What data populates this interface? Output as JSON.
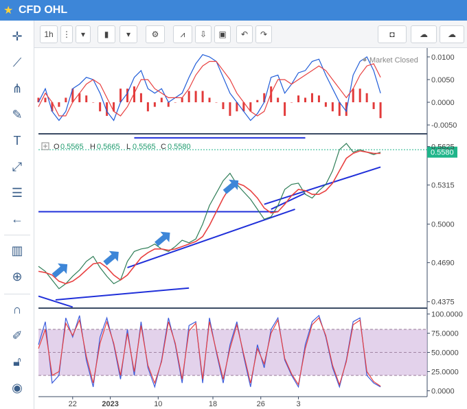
{
  "window": {
    "title": "CFD OHL"
  },
  "toolbar": {
    "interval": "1h"
  },
  "icons": [
    "star-icon",
    "crosshair-icon",
    "trendline-icon",
    "pitchfork-icon",
    "brush-icon",
    "text-icon",
    "pattern-icon",
    "fib-icon",
    "back-arrow-icon",
    "bar-chart-icon",
    "zoom-in-icon",
    "magnet-icon",
    "lock-pencil-icon",
    "unlock-icon",
    "eye-icon",
    "candlestick-icon",
    "gear-icon",
    "indicators-icon",
    "arrow-down-save-icon",
    "save-icon",
    "undo-icon",
    "redo-icon",
    "camera-icon",
    "cloud-download-icon",
    "cloud-upload-icon"
  ],
  "colors": {
    "accent": "#3d86d8",
    "price_line": "#1e5bd8",
    "ma": "#e84040",
    "hist": "#e23b3b",
    "stoch_band": "#d7bfe3",
    "last_price": "#1fb58a",
    "drawing": "#1f2fd9",
    "arrow": "#3d86d8"
  },
  "chart_data": [
    {
      "type": "line",
      "name": "macd-pane",
      "status": "Market Closed",
      "ylim": [
        -0.0065,
        0.0115
      ],
      "yticks": [
        "0.0100",
        "0.0050",
        "0.0000",
        "-0.0050"
      ],
      "x": [
        0,
        2,
        4,
        6,
        8,
        10,
        12,
        14,
        16,
        18,
        20,
        22,
        24,
        26,
        28,
        30,
        32,
        34,
        36,
        38,
        40,
        42,
        44,
        46,
        48,
        50,
        52,
        54,
        56,
        58,
        60,
        62,
        64,
        66,
        68,
        70,
        72,
        74,
        76,
        78,
        80,
        82,
        84,
        86,
        88,
        90,
        92,
        94,
        96,
        98,
        100
      ],
      "series": [
        {
          "values": [
            0.0,
            0.003,
            -0.002,
            -0.004,
            -0.002,
            0.003,
            0.004,
            0.0055,
            0.005,
            0.002,
            -0.002,
            -0.004,
            0.0,
            0.002,
            0.0055,
            0.007,
            0.003,
            0.002,
            0.003,
            0.0,
            0.001,
            0.002,
            0.0055,
            0.0085,
            0.0105,
            0.01,
            0.009,
            0.0055,
            0.002,
            0.0,
            -0.002,
            -0.004,
            -0.0025,
            0.0,
            0.0055,
            0.006,
            0.002,
            0.004,
            0.0065,
            0.007,
            0.009,
            0.0095,
            0.006,
            0.003,
            0.0,
            -0.002,
            0.006,
            0.009,
            0.01,
            0.007,
            0.002
          ]
        },
        {
          "values": [
            -0.001,
            0.002,
            0.0,
            -0.003,
            -0.003,
            0.0,
            0.002,
            0.004,
            0.005,
            0.004,
            0.001,
            -0.002,
            -0.003,
            -0.001,
            0.002,
            0.005,
            0.005,
            0.003,
            0.002,
            0.001,
            0.001,
            0.001,
            0.003,
            0.006,
            0.008,
            0.009,
            0.009,
            0.007,
            0.005,
            0.002,
            0.0,
            -0.002,
            -0.003,
            -0.002,
            0.002,
            0.005,
            0.005,
            0.004,
            0.005,
            0.006,
            0.007,
            0.008,
            0.007,
            0.005,
            0.003,
            0.001,
            0.003,
            0.006,
            0.008,
            0.0085,
            0.0055
          ]
        }
      ],
      "histogram": [
        0.001,
        0.001,
        -0.002,
        -0.001,
        0.001,
        0.003,
        0.002,
        0.0015,
        0.0,
        -0.002,
        -0.003,
        -0.002,
        0.003,
        0.003,
        0.0035,
        0.002,
        -0.002,
        -0.001,
        0.001,
        -0.001,
        0.0,
        0.001,
        0.0025,
        0.0025,
        0.0025,
        0.001,
        0.0,
        -0.0015,
        -0.003,
        -0.002,
        -0.002,
        -0.002,
        0.0005,
        0.002,
        0.0035,
        0.001,
        -0.003,
        0.0,
        0.0015,
        0.001,
        0.002,
        0.0015,
        -0.001,
        -0.002,
        -0.003,
        -0.003,
        0.003,
        0.003,
        0.002,
        -0.0015,
        -0.0035
      ]
    },
    {
      "type": "line",
      "name": "price-pane",
      "ohlc": {
        "o_label": "O",
        "o": "0.5565",
        "h_label": "H",
        "h": "0.5665",
        "l_label": "L",
        "l": "0.5565",
        "c_label": "C",
        "c": "0.5580"
      },
      "ylim": [
        0.434,
        0.57
      ],
      "yticks": [
        "0.5625",
        "0.5315",
        "0.5000",
        "0.4690",
        "0.4375"
      ],
      "last_price": "0.5580",
      "last_price_value": 0.558,
      "x": [
        0,
        2,
        4,
        6,
        8,
        10,
        12,
        14,
        16,
        18,
        20,
        22,
        24,
        26,
        28,
        30,
        32,
        34,
        36,
        38,
        40,
        42,
        44,
        46,
        48,
        50,
        52,
        54,
        56,
        58,
        60,
        62,
        64,
        66,
        68,
        70,
        72,
        74,
        76,
        78,
        80,
        82,
        84,
        86,
        88,
        90,
        92,
        94,
        96,
        98,
        100
      ],
      "series": [
        {
          "values": [
            0.466,
            0.462,
            0.455,
            0.448,
            0.452,
            0.458,
            0.463,
            0.47,
            0.474,
            0.465,
            0.458,
            0.452,
            0.455,
            0.47,
            0.478,
            0.48,
            0.481,
            0.484,
            0.48,
            0.478,
            0.482,
            0.487,
            0.485,
            0.488,
            0.5,
            0.515,
            0.525,
            0.535,
            0.541,
            0.532,
            0.526,
            0.52,
            0.512,
            0.504,
            0.506,
            0.515,
            0.528,
            0.532,
            0.533,
            0.524,
            0.521,
            0.527,
            0.532,
            0.543,
            0.56,
            0.565,
            0.558,
            0.56,
            0.558,
            0.556,
            0.558
          ]
        },
        {
          "values": [
            0.462,
            0.461,
            0.459,
            0.454,
            0.452,
            0.454,
            0.458,
            0.463,
            0.468,
            0.469,
            0.465,
            0.459,
            0.455,
            0.459,
            0.466,
            0.473,
            0.477,
            0.48,
            0.48,
            0.479,
            0.48,
            0.482,
            0.484,
            0.486,
            0.49,
            0.499,
            0.51,
            0.521,
            0.53,
            0.533,
            0.531,
            0.527,
            0.521,
            0.513,
            0.509,
            0.51,
            0.516,
            0.523,
            0.528,
            0.527,
            0.524,
            0.524,
            0.527,
            0.533,
            0.543,
            0.553,
            0.557,
            0.559,
            0.558,
            0.557,
            0.557
          ]
        }
      ],
      "arrows": [
        [
          6,
          0.462
        ],
        [
          21,
          0.472
        ],
        [
          36,
          0.4875
        ],
        [
          56,
          0.5295
        ]
      ],
      "drawn_lines": [
        [
          [
            0,
            0.442
          ],
          [
            10,
            0.4332
          ]
        ],
        [
          [
            5,
            0.439
          ],
          [
            44,
            0.4485
          ]
        ],
        [
          [
            0,
            0.51
          ],
          [
            70,
            0.51
          ]
        ],
        [
          [
            26,
            0.465
          ],
          [
            75,
            0.512
          ]
        ],
        [
          [
            68,
            0.512
          ],
          [
            78,
            0.525
          ]
        ],
        [
          [
            66,
            0.516
          ],
          [
            100,
            0.546
          ]
        ],
        [
          [
            28,
            0.5695
          ],
          [
            78,
            0.5695
          ]
        ]
      ],
      "hline": 0.56
    },
    {
      "type": "line",
      "name": "stochastic-pane",
      "ylim": [
        -5,
        105
      ],
      "yticks": [
        "100.0000",
        "75.0000",
        "50.0000",
        "25.0000",
        "0.0000"
      ],
      "band": [
        20,
        80
      ],
      "x_ticks": [
        [
          10,
          "22"
        ],
        [
          21,
          "2023"
        ],
        [
          35,
          "10"
        ],
        [
          51,
          "18"
        ],
        [
          65,
          "26"
        ],
        [
          76,
          "3"
        ]
      ],
      "x": [
        0,
        2,
        4,
        6,
        8,
        10,
        12,
        14,
        16,
        18,
        20,
        22,
        24,
        26,
        28,
        30,
        32,
        34,
        36,
        38,
        40,
        42,
        44,
        46,
        48,
        50,
        52,
        54,
        56,
        58,
        60,
        62,
        64,
        66,
        68,
        70,
        72,
        74,
        76,
        78,
        80,
        82,
        84,
        86,
        88,
        90,
        92,
        94,
        96,
        98,
        100
      ],
      "series": [
        {
          "values": [
            60,
            90,
            10,
            20,
            95,
            70,
            98,
            40,
            5,
            70,
            95,
            60,
            15,
            80,
            20,
            90,
            30,
            5,
            40,
            95,
            60,
            10,
            85,
            90,
            10,
            95,
            50,
            10,
            60,
            90,
            45,
            5,
            60,
            30,
            80,
            95,
            40,
            20,
            5,
            60,
            90,
            98,
            70,
            30,
            5,
            40,
            90,
            95,
            20,
            10,
            5
          ]
        },
        {
          "values": [
            55,
            80,
            20,
            25,
            88,
            72,
            92,
            45,
            10,
            62,
            90,
            62,
            20,
            75,
            25,
            85,
            33,
            10,
            38,
            90,
            62,
            15,
            78,
            88,
            15,
            90,
            52,
            15,
            55,
            86,
            48,
            10,
            55,
            35,
            75,
            92,
            42,
            22,
            8,
            55,
            86,
            95,
            72,
            33,
            8,
            38,
            86,
            92,
            25,
            12,
            6
          ]
        }
      ]
    }
  ]
}
